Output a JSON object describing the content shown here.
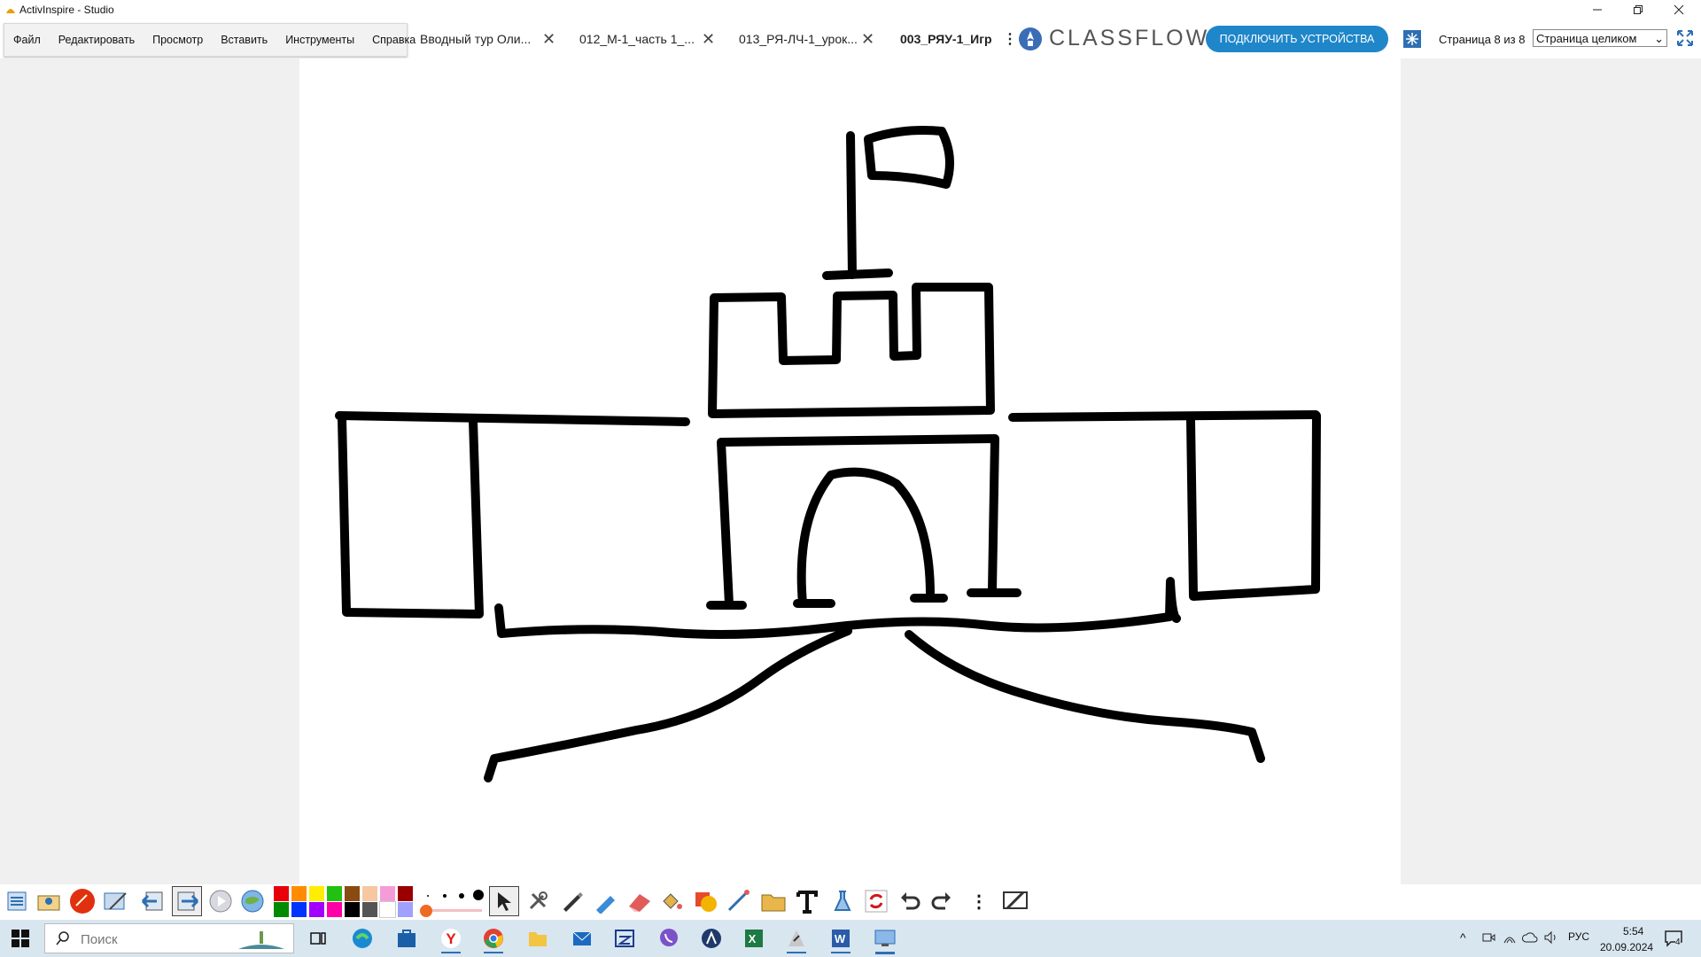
{
  "window": {
    "title": "ActivInspire - Studio"
  },
  "menu": [
    "Файл",
    "Редактировать",
    "Просмотр",
    "Вставить",
    "Инструменты",
    "Справка"
  ],
  "tabs": [
    {
      "label": "Вводный тур Оли..."
    },
    {
      "label": "012_М-1_часть 1_..."
    },
    {
      "label": "013_РЯ-ЛЧ-1_урок..."
    },
    {
      "label": "003_РЯУ-1_Игр"
    }
  ],
  "classflow": {
    "brand": "CLASSFLOW",
    "connect_label": "ПОДКЛЮЧИТЬ УСТРОЙСТВА"
  },
  "page_nav": {
    "counter": "Страница 8 из 8",
    "zoom": "Страница целиком"
  },
  "colors": {
    "accent": "#1e86c9",
    "palette_row1": [
      "#e8000b",
      "#ff8c00",
      "#ffee00",
      "#22c010",
      "#8a4b13",
      "#f6c7a0",
      "#f59cd8",
      "#9a0000"
    ],
    "palette_row2": [
      "#008a00",
      "#0033ff",
      "#a100ff",
      "#ff00a8",
      "#000000",
      "#555555",
      "#ffffff",
      "#9fa0ff"
    ]
  },
  "taskbar": {
    "search_placeholder": "Поиск",
    "lang": "РУС",
    "time": "5:54",
    "date": "20.09.2024",
    "notification_count": "4"
  }
}
